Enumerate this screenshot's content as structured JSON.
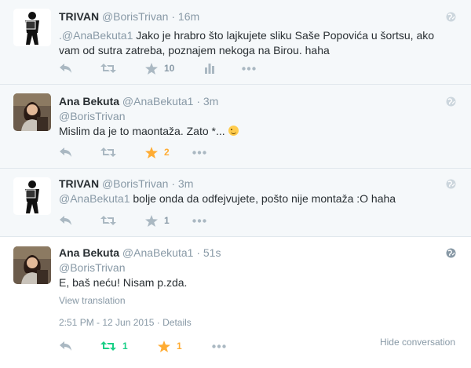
{
  "tweets": [
    {
      "name": "TRIVAN",
      "handle": "@BorisTrivan",
      "sep": "·",
      "time": "16m",
      "mention": ".@AnaBekuta1",
      "text": " Jako je hrabro što lajkujete sliku Saše Popovića u šortsu, ako vam od sutra zatreba, poznajem nekoga na Birou. haha",
      "favorites": "10",
      "retweets": ""
    },
    {
      "name": "Ana Bekuta",
      "handle": "@AnaBekuta1",
      "sep": "·",
      "time": "3m",
      "mention": "@BorisTrivan",
      "text": "Mislim da je to maontaža. Zato *...",
      "favorites": "2",
      "retweets": ""
    },
    {
      "name": "TRIVAN",
      "handle": "@BorisTrivan",
      "sep": "·",
      "time": "3m",
      "mention": "@AnaBekuta1",
      "text": " bolje onda da odfejvujete, pošto nije montaža :O haha",
      "favorites": "1",
      "retweets": ""
    },
    {
      "name": "Ana Bekuta",
      "handle": "@AnaBekuta1",
      "sep": "·",
      "time": "51s",
      "mention": "@BorisTrivan",
      "text": "E, baš neću! Nisam p.zda.",
      "view_translation": "View translation",
      "timestamp": "2:51 PM - 12 Jun 2015",
      "details_sep": "·",
      "details": "Details",
      "favorites": "1",
      "retweets": "1",
      "hide_conversation": "Hide conversation"
    }
  ],
  "icons": {
    "reply": "reply-icon",
    "retweet": "retweet-icon",
    "favorite": "star-icon",
    "analytics": "analytics-icon",
    "more": "more-dots-icon",
    "globe": "globe-icon",
    "emoji": "winking-face-icon"
  },
  "colors": {
    "icon_grey": "#aab8c2",
    "favorite_gold": "#ffac33",
    "retweet_green": "#19cf86",
    "meta_grey": "#8899a6",
    "text": "#292f33",
    "faded_bg": "#f5f8fa",
    "focus_bg": "#ffffff"
  }
}
